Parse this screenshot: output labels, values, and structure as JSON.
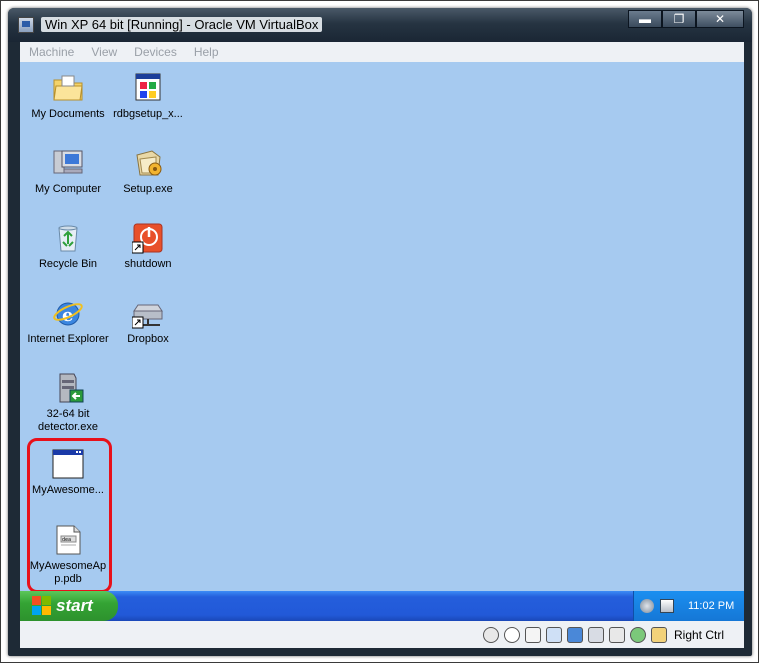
{
  "window": {
    "title": "Win XP 64 bit [Running] - Oracle VM VirtualBox",
    "minimize": "▬",
    "maximize": "❐",
    "close": "✕"
  },
  "menu": [
    "Machine",
    "View",
    "Devices",
    "Help"
  ],
  "desktop_icons": [
    {
      "name": "my-documents",
      "label": "My Documents",
      "icon": "folder-icon"
    },
    {
      "name": "rdbgsetup",
      "label": "rdbgsetup_x...",
      "icon": "installer-icon"
    },
    {
      "name": "my-computer",
      "label": "My Computer",
      "icon": "computer-icon"
    },
    {
      "name": "setup",
      "label": "Setup.exe",
      "icon": "setup-icon"
    },
    {
      "name": "recycle-bin",
      "label": "Recycle Bin",
      "icon": "recycle-bin-icon"
    },
    {
      "name": "shutdown",
      "label": "shutdown",
      "icon": "power-icon"
    },
    {
      "name": "internet-explorer",
      "label": "Internet Explorer",
      "icon": "ie-icon"
    },
    {
      "name": "dropbox",
      "label": "Dropbox",
      "icon": "network-drive-icon"
    },
    {
      "name": "detector",
      "label": "32-64 bit detector.exe",
      "icon": "server-icon"
    },
    {
      "name": "myawesome-exe",
      "label": "MyAwesome...",
      "icon": "app-window-icon"
    },
    {
      "name": "myawesome-pdb",
      "label": "MyAwesomeAp p.pdb",
      "icon": "document-icon"
    }
  ],
  "taskbar": {
    "start_label": "start",
    "time": "11:02 PM"
  },
  "statusbar": {
    "host_key": "Right Ctrl"
  },
  "colors": {
    "desktop": "#a6caf0",
    "taskbar": "#245edc",
    "start_button": "#34a434",
    "highlight": "#e8101a"
  }
}
